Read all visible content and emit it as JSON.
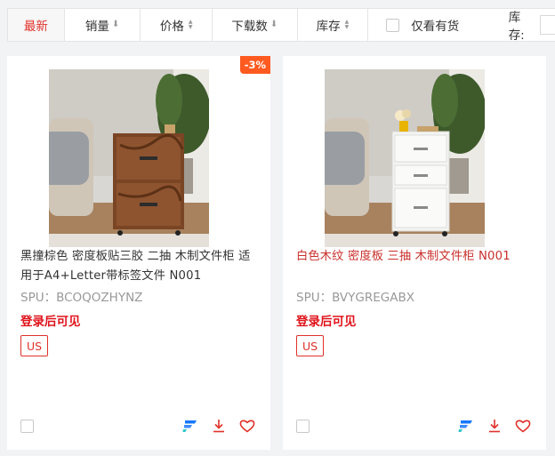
{
  "sort_bar": {
    "items": [
      {
        "label": "最新",
        "active": true
      },
      {
        "label": "销量",
        "arrow": "down"
      },
      {
        "label": "价格",
        "arrow": "updown"
      },
      {
        "label": "下载数",
        "arrow": "down"
      },
      {
        "label": "库存",
        "arrow": "updown"
      }
    ],
    "in_stock_label": "仅看有货",
    "stock_filter_label": "库存:"
  },
  "products": [
    {
      "discount": "-3%",
      "title": "黑撞棕色 密度板贴三胶 二抽 木制文件柜 适用于A4+Letter带标签文件 N001",
      "spu": "SPU：BCOQOZHYNZ",
      "price_notice": "登录后可见",
      "tag": "US",
      "cabinet_style": "rustic",
      "title_color": "#333333"
    },
    {
      "discount": "",
      "title": "白色木纹 密度板 三抽 木制文件柜 N001",
      "spu": "SPU：BVYGREGABX",
      "price_notice": "登录后可见",
      "tag": "US",
      "cabinet_style": "white",
      "title_color": "#c9302c"
    }
  ],
  "colors": {
    "accent": "#e0312a",
    "discount_bg": "#ff5a1f",
    "brand_icon": "#1677ff"
  },
  "icons": [
    "checkbox-icon",
    "brand-f-icon",
    "download-icon",
    "heart-icon"
  ]
}
